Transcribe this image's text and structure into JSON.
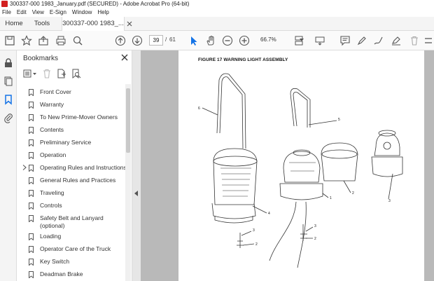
{
  "window": {
    "title": "300337-000 1983_January.pdf (SECURED) - Adobe Acrobat Pro (64-bit)"
  },
  "menu": [
    "File",
    "Edit",
    "View",
    "E-Sign",
    "Window",
    "Help"
  ],
  "tabs": {
    "home": "Home",
    "tools": "Tools",
    "document": "300337-000 1983_..."
  },
  "toolbar": {
    "page_current": "39",
    "page_separator": "/",
    "page_total": "61",
    "zoom": "66.7%"
  },
  "bookmarks_panel": {
    "title": "Bookmarks",
    "items": [
      {
        "label": "Front Cover"
      },
      {
        "label": "Warranty"
      },
      {
        "label": "To New Prime-Mover Owners"
      },
      {
        "label": "Contents"
      },
      {
        "label": "Preliminary Service"
      },
      {
        "label": "Operation"
      },
      {
        "label": "Operating Rules and Instructions",
        "expandable": true
      },
      {
        "label": "General Rules and Practices"
      },
      {
        "label": "Traveling"
      },
      {
        "label": "Controls"
      },
      {
        "label": "Safety Belt and Lanyard (optional)"
      },
      {
        "label": "Loading"
      },
      {
        "label": "Operator Care of the Truck"
      },
      {
        "label": "Key Switch"
      },
      {
        "label": "Deadman Brake"
      }
    ]
  },
  "document": {
    "figure_title": "FIGURE 17 WARNING LIGHT ASSEMBLY",
    "callouts": [
      "6",
      "5",
      "4",
      "1",
      "2",
      "3",
      "3",
      "2",
      "3",
      "2"
    ]
  },
  "colors": {
    "acrobat_red": "#d21f1f",
    "accent_blue": "#1473e6",
    "doc_background": "#b9b9b9"
  }
}
